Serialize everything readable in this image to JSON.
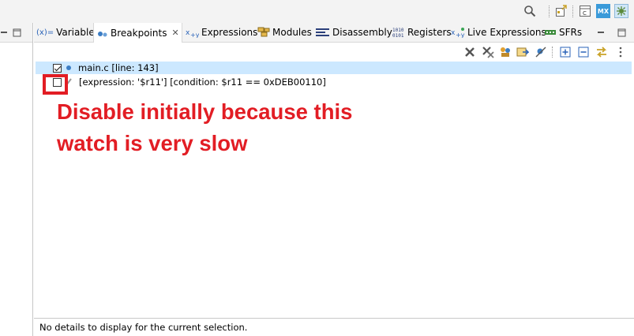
{
  "toolbar": {
    "icons": [
      "search-icon",
      "debug-view-icon",
      "perspective-icon",
      "cpp-perspective-icon",
      "mx-icon",
      "debug-perspective-icon"
    ],
    "mx_label": "MX"
  },
  "tabs": [
    {
      "label": "Variables",
      "prefix": "(x)=",
      "icon": "variables-icon"
    },
    {
      "label": "Breakpoints",
      "icon": "breakpoints-icon",
      "active": true,
      "close": "✕"
    },
    {
      "label": "Expressions",
      "icon": "expressions-icon"
    },
    {
      "label": "Modules",
      "icon": "modules-icon"
    },
    {
      "label": "Disassembly",
      "icon": "disassembly-icon"
    },
    {
      "label": "Registers",
      "icon": "registers-icon",
      "glyph": "1010\n0101"
    },
    {
      "label": "Live Expressions",
      "icon": "live-expressions-icon"
    },
    {
      "label": "SFRs",
      "icon": "sfrs-icon"
    }
  ],
  "breakpoints": [
    {
      "label": "main.c [line: 143]",
      "checked": true,
      "selected": true
    },
    {
      "label": "[expression: '$r11'] [condition: $r11 == 0xDEB00110]",
      "checked": false,
      "selected": false
    }
  ],
  "annotation": {
    "line1": "Disable initially because this",
    "line2": "watch is very slow",
    "color": "#e21d24"
  },
  "status": {
    "text": "No details to display for the current selection."
  },
  "colors": {
    "selection": "#cce8ff",
    "toolbar_bg": "#f3f3f3",
    "annotation_red": "#e21d24"
  }
}
